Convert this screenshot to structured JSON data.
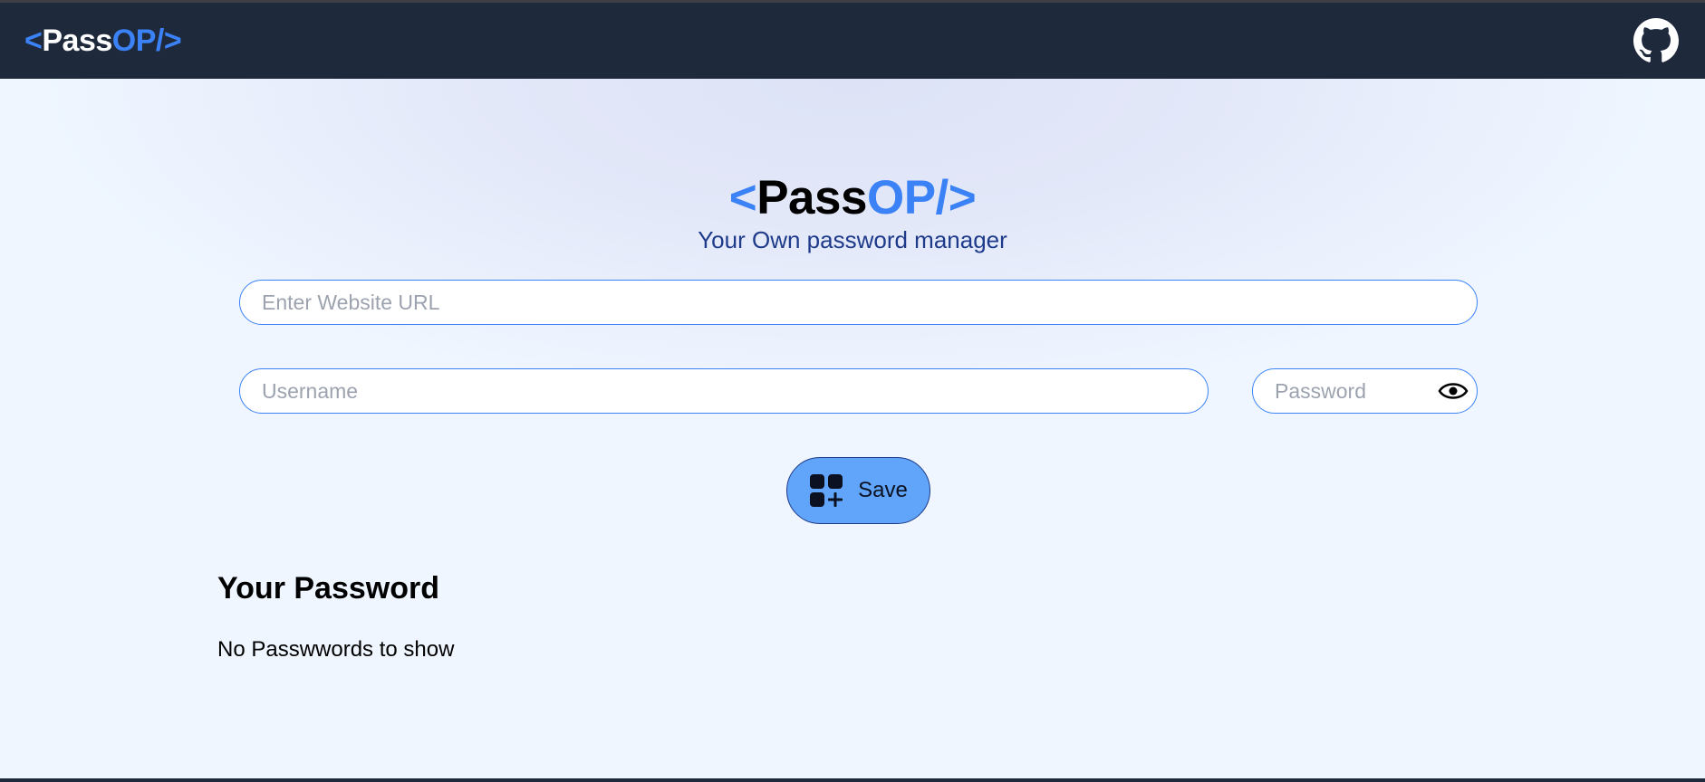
{
  "nav": {
    "logo_open": "<",
    "logo_pass": "Pass",
    "logo_op": "OP/>",
    "github_icon": "github-icon"
  },
  "hero": {
    "logo_open": "<",
    "logo_pass": "Pass",
    "logo_op": "OP/>",
    "tagline": "Your Own password manager"
  },
  "form": {
    "url_placeholder": "Enter Website URL",
    "url_value": "",
    "username_placeholder": "Username",
    "username_value": "",
    "password_placeholder": "Password",
    "password_value": "",
    "show_password_icon": "eye-icon",
    "save_icon": "add-grid-icon",
    "save_label": "Save"
  },
  "passwords": {
    "title": "Your Password",
    "empty_message": "No Passwwords to show"
  },
  "colors": {
    "navbar": "#1e293b",
    "accent": "#3b82f6",
    "button": "#60a5fa",
    "background": "#eff6ff"
  }
}
